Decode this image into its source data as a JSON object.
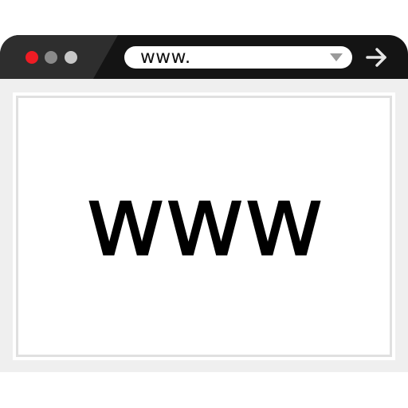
{
  "window": {
    "controls": {
      "close_color": "#ee1c24",
      "minimize_color": "#8a8a8a",
      "maximize_color": "#c8c8c8"
    },
    "address_bar": {
      "value": "www.",
      "dropdown_icon": "chevron-down-icon"
    },
    "go_icon": "arrow-right-icon"
  },
  "page": {
    "heading": "www"
  }
}
